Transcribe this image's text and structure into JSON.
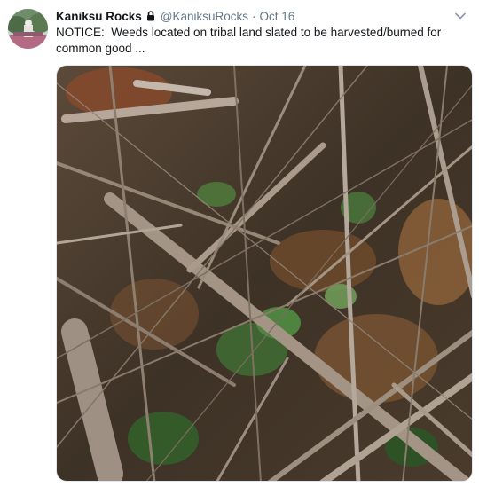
{
  "tweet": {
    "display_name": "Kaniksu Rocks",
    "handle": "@KaniksuRocks",
    "separator": "·",
    "date": "Oct 16",
    "text": "NOTICE:  Weeds located on tribal land slated to be harvested/burned for common good ...",
    "protected": true
  },
  "icons": {
    "lock": "lock-icon",
    "caret": "chevron-down-icon"
  },
  "media": {
    "description_subject": "brush-pile-photo"
  },
  "colors": {
    "text_primary": "#14171a",
    "text_secondary": "#657786",
    "caret": "#8899a6"
  }
}
